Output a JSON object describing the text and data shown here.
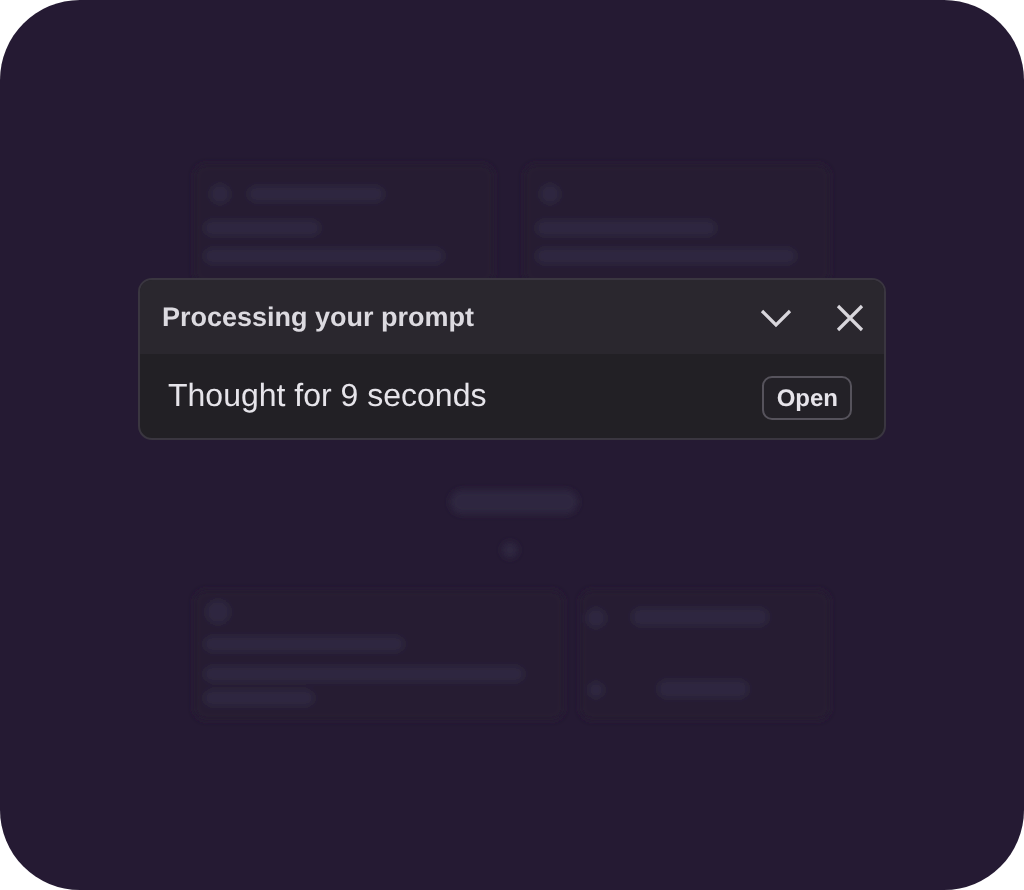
{
  "dialog": {
    "title": "Processing your prompt",
    "message": "Thought for 9 seconds",
    "button": "Open"
  }
}
